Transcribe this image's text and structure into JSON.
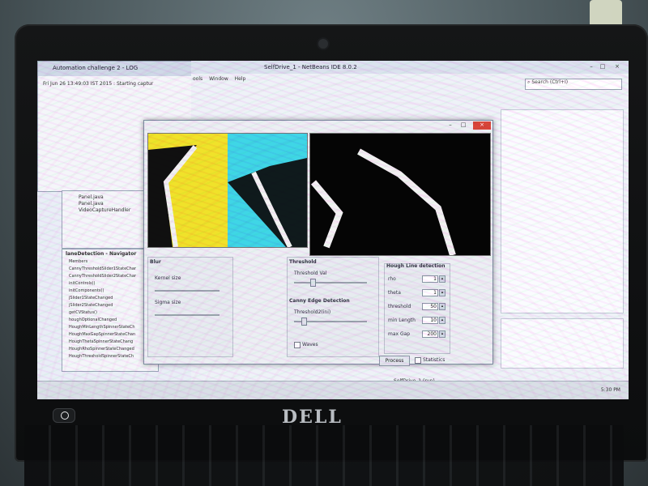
{
  "log_window": {
    "title": "Automation challenge 2 - LOG",
    "line": "Fri Jun 26 13:49:03 IST 2015 : Starting captur"
  },
  "ide": {
    "title": "SelfDrive_1 - NetBeans IDE 8.0.2",
    "menu": [
      "ools",
      "Window",
      "Help"
    ],
    "search_placeholder": "Search (Ctrl+I)",
    "navigator_title": "laneDetection - Navigator",
    "navigator_items": [
      "Members",
      "CannyThresholdSlider1StateChar",
      "CannyThresholdSlider2StateChar",
      "initControls()",
      "initComponents()",
      "jSlider1StateChanged",
      "jSlider2StateChanged",
      "getCVStatus()",
      "houghOptionalChanged",
      "HoughMinLengthSpinnerStateCh",
      "HoughMaxGapSpinnerStateChan",
      "HoughThetaSpinnerStateChang",
      "HoughRhoSpinnerStateChanged",
      "HoughThresholdSpinnerStateCh"
    ],
    "project_items": [
      "Panel.java",
      "Panel.java",
      "VideoCaptureHandler"
    ],
    "status_bar": "SelfDrive_1 (run)"
  },
  "dialog": {
    "blur": {
      "title": "Blur",
      "labels": [
        "Kernel size",
        "Sigma size"
      ]
    },
    "threshold": {
      "title": "Threshold",
      "label": "Threshold Val",
      "value_fraction": 0.22
    },
    "canny": {
      "title": "Canny Edge Detection",
      "label": "Threshold2(ini)",
      "value_fraction": 0.1
    },
    "hough": {
      "title": "Hough Line detection",
      "fields": [
        {
          "label": "rho",
          "value": "1"
        },
        {
          "label": "theta",
          "value": "1"
        },
        {
          "label": "threshold",
          "value": "50"
        },
        {
          "label": "min Length",
          "value": "10"
        },
        {
          "label": "max Gap",
          "value": "200"
        }
      ]
    },
    "buttons": {
      "process": "Process",
      "checkbox": "Statistics",
      "waves": "Waves"
    }
  },
  "taskbar": {
    "clock": "5:30 PM"
  },
  "brand": "DELL",
  "colors": {
    "yellow": "#f0e22a",
    "cyan": "#3fd6e6",
    "road": "#101010",
    "stripe": "#f2f2f2"
  }
}
